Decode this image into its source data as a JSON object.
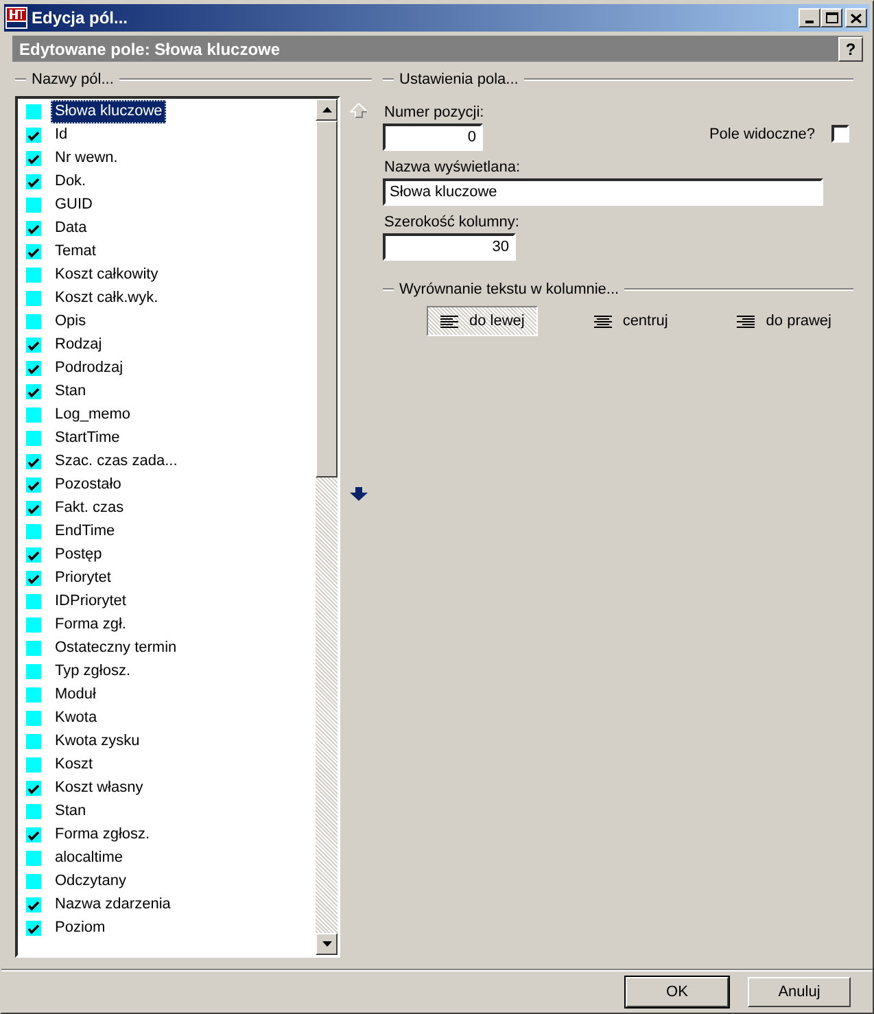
{
  "window": {
    "title": "Edycja pól..."
  },
  "header": {
    "title": "Edytowane pole: Słowa kluczowe",
    "help": "?"
  },
  "fields_group": {
    "label": "Nazwy pól...",
    "items": [
      {
        "label": "Słowa kluczowe",
        "checked": false,
        "selected": true
      },
      {
        "label": "Id",
        "checked": true,
        "selected": false
      },
      {
        "label": "Nr wewn.",
        "checked": true,
        "selected": false
      },
      {
        "label": "Dok.",
        "checked": true,
        "selected": false
      },
      {
        "label": "GUID",
        "checked": false,
        "selected": false
      },
      {
        "label": "Data",
        "checked": true,
        "selected": false
      },
      {
        "label": "Temat",
        "checked": true,
        "selected": false
      },
      {
        "label": "Koszt całkowity",
        "checked": false,
        "selected": false
      },
      {
        "label": "Koszt całk.wyk.",
        "checked": false,
        "selected": false
      },
      {
        "label": "Opis",
        "checked": false,
        "selected": false
      },
      {
        "label": "Rodzaj",
        "checked": true,
        "selected": false
      },
      {
        "label": "Podrodzaj",
        "checked": true,
        "selected": false
      },
      {
        "label": "Stan",
        "checked": true,
        "selected": false
      },
      {
        "label": "Log_memo",
        "checked": false,
        "selected": false
      },
      {
        "label": "StartTime",
        "checked": false,
        "selected": false
      },
      {
        "label": "Szac. czas zada...",
        "checked": true,
        "selected": false
      },
      {
        "label": "Pozostało",
        "checked": true,
        "selected": false
      },
      {
        "label": "Fakt. czas",
        "checked": true,
        "selected": false
      },
      {
        "label": "EndTime",
        "checked": false,
        "selected": false
      },
      {
        "label": "Postęp",
        "checked": true,
        "selected": false
      },
      {
        "label": "Priorytet",
        "checked": true,
        "selected": false
      },
      {
        "label": "IDPriorytet",
        "checked": false,
        "selected": false
      },
      {
        "label": "Forma zgł.",
        "checked": false,
        "selected": false
      },
      {
        "label": "Ostateczny termin",
        "checked": false,
        "selected": false
      },
      {
        "label": "Typ zgłosz.",
        "checked": false,
        "selected": false
      },
      {
        "label": "Moduł",
        "checked": false,
        "selected": false
      },
      {
        "label": "Kwota",
        "checked": false,
        "selected": false
      },
      {
        "label": "Kwota zysku",
        "checked": false,
        "selected": false
      },
      {
        "label": "Koszt",
        "checked": false,
        "selected": false
      },
      {
        "label": "Koszt własny",
        "checked": true,
        "selected": false
      },
      {
        "label": "Stan",
        "checked": false,
        "selected": false
      },
      {
        "label": "Forma zgłosz.",
        "checked": true,
        "selected": false
      },
      {
        "label": "alocaltime",
        "checked": false,
        "selected": false
      },
      {
        "label": "Odczytany",
        "checked": false,
        "selected": false
      },
      {
        "label": "Nazwa zdarzenia",
        "checked": true,
        "selected": false
      },
      {
        "label": "Poziom",
        "checked": true,
        "selected": false
      }
    ]
  },
  "settings_group": {
    "label": "Ustawienia pola...",
    "position": {
      "label": "Numer pozycji:",
      "value": "0"
    },
    "visible": {
      "label": "Pole widoczne?",
      "checked": false
    },
    "display_name": {
      "label": "Nazwa wyświetlana:",
      "value": "Słowa kluczowe"
    },
    "column_width": {
      "label": "Szerokość kolumny:",
      "value": "30"
    },
    "alignment": {
      "label": "Wyrównanie tekstu w kolumnie...",
      "options": [
        {
          "kind": "left",
          "label": "do lewej",
          "selected": true
        },
        {
          "kind": "center",
          "label": "centruj",
          "selected": false
        },
        {
          "kind": "right",
          "label": "do prawej",
          "selected": false
        }
      ]
    }
  },
  "buttons": [
    "OK",
    "Anuluj"
  ]
}
